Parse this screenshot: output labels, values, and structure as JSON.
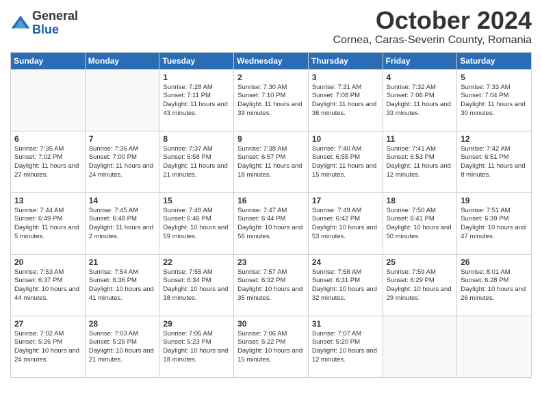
{
  "logo": {
    "general": "General",
    "blue": "Blue"
  },
  "title": "October 2024",
  "location": "Cornea, Caras-Severin County, Romania",
  "weekdays": [
    "Sunday",
    "Monday",
    "Tuesday",
    "Wednesday",
    "Thursday",
    "Friday",
    "Saturday"
  ],
  "weeks": [
    [
      {
        "day": "",
        "info": ""
      },
      {
        "day": "",
        "info": ""
      },
      {
        "day": "1",
        "info": "Sunrise: 7:28 AM\nSunset: 7:11 PM\nDaylight: 11 hours and 43 minutes."
      },
      {
        "day": "2",
        "info": "Sunrise: 7:30 AM\nSunset: 7:10 PM\nDaylight: 11 hours and 39 minutes."
      },
      {
        "day": "3",
        "info": "Sunrise: 7:31 AM\nSunset: 7:08 PM\nDaylight: 11 hours and 36 minutes."
      },
      {
        "day": "4",
        "info": "Sunrise: 7:32 AM\nSunset: 7:06 PM\nDaylight: 11 hours and 33 minutes."
      },
      {
        "day": "5",
        "info": "Sunrise: 7:33 AM\nSunset: 7:04 PM\nDaylight: 11 hours and 30 minutes."
      }
    ],
    [
      {
        "day": "6",
        "info": "Sunrise: 7:35 AM\nSunset: 7:02 PM\nDaylight: 11 hours and 27 minutes."
      },
      {
        "day": "7",
        "info": "Sunrise: 7:36 AM\nSunset: 7:00 PM\nDaylight: 11 hours and 24 minutes."
      },
      {
        "day": "8",
        "info": "Sunrise: 7:37 AM\nSunset: 6:58 PM\nDaylight: 11 hours and 21 minutes."
      },
      {
        "day": "9",
        "info": "Sunrise: 7:38 AM\nSunset: 6:57 PM\nDaylight: 11 hours and 18 minutes."
      },
      {
        "day": "10",
        "info": "Sunrise: 7:40 AM\nSunset: 6:55 PM\nDaylight: 11 hours and 15 minutes."
      },
      {
        "day": "11",
        "info": "Sunrise: 7:41 AM\nSunset: 6:53 PM\nDaylight: 11 hours and 12 minutes."
      },
      {
        "day": "12",
        "info": "Sunrise: 7:42 AM\nSunset: 6:51 PM\nDaylight: 11 hours and 8 minutes."
      }
    ],
    [
      {
        "day": "13",
        "info": "Sunrise: 7:44 AM\nSunset: 6:49 PM\nDaylight: 11 hours and 5 minutes."
      },
      {
        "day": "14",
        "info": "Sunrise: 7:45 AM\nSunset: 6:48 PM\nDaylight: 11 hours and 2 minutes."
      },
      {
        "day": "15",
        "info": "Sunrise: 7:46 AM\nSunset: 6:46 PM\nDaylight: 10 hours and 59 minutes."
      },
      {
        "day": "16",
        "info": "Sunrise: 7:47 AM\nSunset: 6:44 PM\nDaylight: 10 hours and 56 minutes."
      },
      {
        "day": "17",
        "info": "Sunrise: 7:49 AM\nSunset: 6:42 PM\nDaylight: 10 hours and 53 minutes."
      },
      {
        "day": "18",
        "info": "Sunrise: 7:50 AM\nSunset: 6:41 PM\nDaylight: 10 hours and 50 minutes."
      },
      {
        "day": "19",
        "info": "Sunrise: 7:51 AM\nSunset: 6:39 PM\nDaylight: 10 hours and 47 minutes."
      }
    ],
    [
      {
        "day": "20",
        "info": "Sunrise: 7:53 AM\nSunset: 6:37 PM\nDaylight: 10 hours and 44 minutes."
      },
      {
        "day": "21",
        "info": "Sunrise: 7:54 AM\nSunset: 6:36 PM\nDaylight: 10 hours and 41 minutes."
      },
      {
        "day": "22",
        "info": "Sunrise: 7:55 AM\nSunset: 6:34 PM\nDaylight: 10 hours and 38 minutes."
      },
      {
        "day": "23",
        "info": "Sunrise: 7:57 AM\nSunset: 6:32 PM\nDaylight: 10 hours and 35 minutes."
      },
      {
        "day": "24",
        "info": "Sunrise: 7:58 AM\nSunset: 6:31 PM\nDaylight: 10 hours and 32 minutes."
      },
      {
        "day": "25",
        "info": "Sunrise: 7:59 AM\nSunset: 6:29 PM\nDaylight: 10 hours and 29 minutes."
      },
      {
        "day": "26",
        "info": "Sunrise: 8:01 AM\nSunset: 6:28 PM\nDaylight: 10 hours and 26 minutes."
      }
    ],
    [
      {
        "day": "27",
        "info": "Sunrise: 7:02 AM\nSunset: 5:26 PM\nDaylight: 10 hours and 24 minutes."
      },
      {
        "day": "28",
        "info": "Sunrise: 7:03 AM\nSunset: 5:25 PM\nDaylight: 10 hours and 21 minutes."
      },
      {
        "day": "29",
        "info": "Sunrise: 7:05 AM\nSunset: 5:23 PM\nDaylight: 10 hours and 18 minutes."
      },
      {
        "day": "30",
        "info": "Sunrise: 7:06 AM\nSunset: 5:22 PM\nDaylight: 10 hours and 15 minutes."
      },
      {
        "day": "31",
        "info": "Sunrise: 7:07 AM\nSunset: 5:20 PM\nDaylight: 10 hours and 12 minutes."
      },
      {
        "day": "",
        "info": ""
      },
      {
        "day": "",
        "info": ""
      }
    ]
  ]
}
